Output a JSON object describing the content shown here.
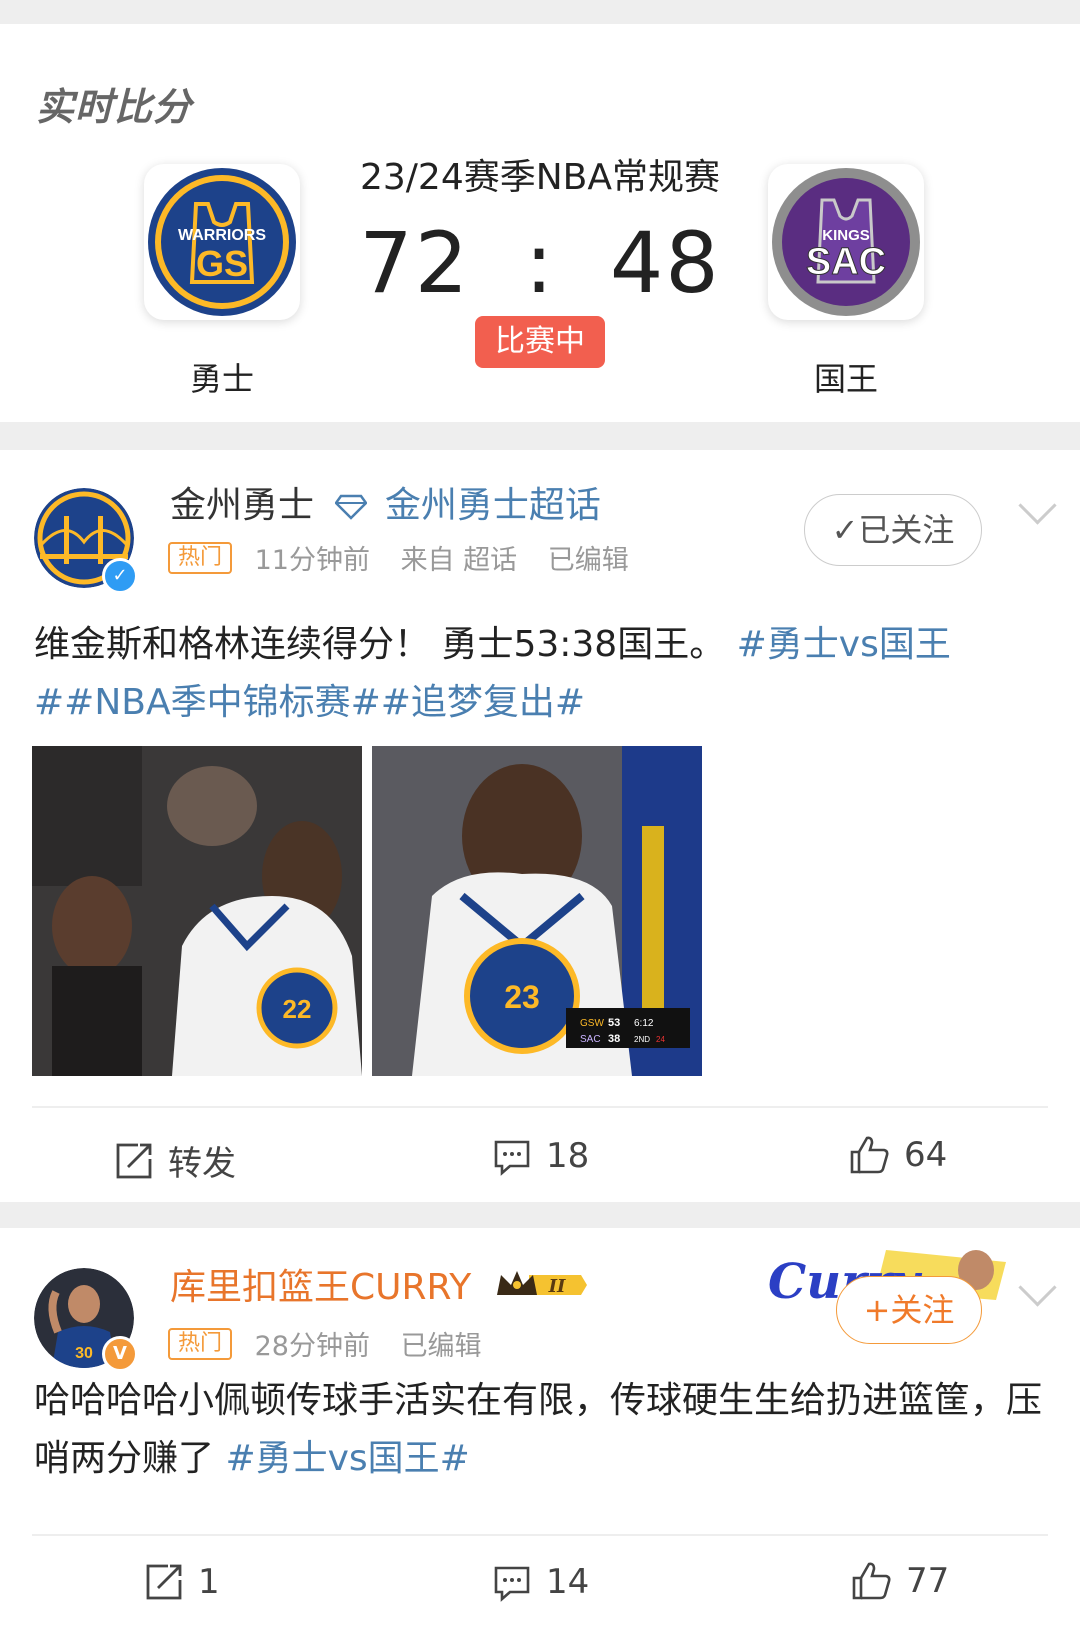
{
  "score_card": {
    "title": "实时比分",
    "league": "23/24赛季NBA常规赛",
    "home": {
      "name": "勇士",
      "logo_text_top": "WARRIORS",
      "logo_text_main": "GS",
      "color": "#1d428a",
      "accent": "#fdb927"
    },
    "away": {
      "name": "国王",
      "logo_text_top": "KINGS",
      "logo_text_main": "SAC",
      "color": "#5a2d81",
      "accent": "#8e8e8e"
    },
    "home_score": "72",
    "separator": ":",
    "away_score": "48",
    "status": "比赛中"
  },
  "post1": {
    "username": "金州勇士",
    "supertopic": "金州勇士超话",
    "hot_tag": "热门",
    "time": "11分钟前",
    "source": "来自 超话",
    "edited": "已编辑",
    "follow_label": "已关注",
    "text": "维金斯和格林连续得分！  勇士53:38国王。 ",
    "tags_line1": "#勇士vs国王",
    "tags_line2": "##NBA季中锦标赛##追梦复出#",
    "scorebug": {
      "team1": "GSW",
      "score1": "53",
      "team2": "SAC",
      "score2": "38",
      "clock": "6:12",
      "quarter": "2ND",
      "shot": "24"
    },
    "jersey_numbers": [
      "22",
      "23"
    ],
    "repost_label": "转发",
    "comments": "18",
    "likes": "64",
    "accent": "#4a7fb0"
  },
  "post2": {
    "username": "库里扣篮王CURRY",
    "level": "II",
    "banner_text": "Curry",
    "hot_tag": "热门",
    "time": "28分钟前",
    "edited": "已编辑",
    "follow_label": "+关注",
    "text": "哈哈哈哈小佩顿传球手活实在有限，传球硬生生给扔进篮筐，压哨两分赚了 ",
    "tags": "#勇士vs国王#",
    "jersey_number": "30",
    "reposts": "1",
    "comments": "14",
    "likes": "77",
    "name_color": "#e8752b"
  }
}
